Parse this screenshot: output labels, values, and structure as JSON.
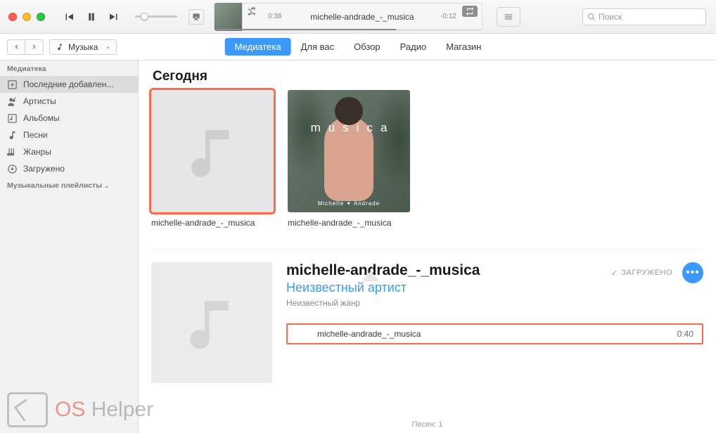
{
  "player": {
    "track_title": "michelle-andrade_-_musica",
    "elapsed": "0:38",
    "remaining": "-0:12"
  },
  "search": {
    "placeholder": "Поиск"
  },
  "source_picker": {
    "label": "Музыка"
  },
  "tabs": {
    "library": "Медиатека",
    "for_you": "Для вас",
    "browse": "Обзор",
    "radio": "Радио",
    "store": "Магазин"
  },
  "sidebar": {
    "library_header": "Медиатека",
    "items": [
      {
        "label": "Последние добавлен..."
      },
      {
        "label": "Артисты"
      },
      {
        "label": "Альбомы"
      },
      {
        "label": "Песни"
      },
      {
        "label": "Жанры"
      },
      {
        "label": "Загружено"
      }
    ],
    "playlists_header": "Музыкальные плейлисты"
  },
  "main": {
    "section_title": "Сегодня",
    "albums": [
      {
        "name": "michelle-andrade_-_musica"
      },
      {
        "name": "michelle-andrade_-_musica",
        "cover_title": "musica",
        "cover_brand": "Michelle ✦ Andrade"
      }
    ],
    "footer_count": "Песен: 1"
  },
  "detail": {
    "title": "michelle-andrade_-_musica",
    "artist": "Неизвестный артист",
    "genre": "Неизвестный жанр",
    "status": "ЗАГРУЖЕНО",
    "tracks": [
      {
        "num": "",
        "name": "michelle-andrade_-_musica",
        "duration": "0:40"
      }
    ]
  },
  "watermark": {
    "brand_a": "OS",
    "brand_b": " Helper"
  }
}
